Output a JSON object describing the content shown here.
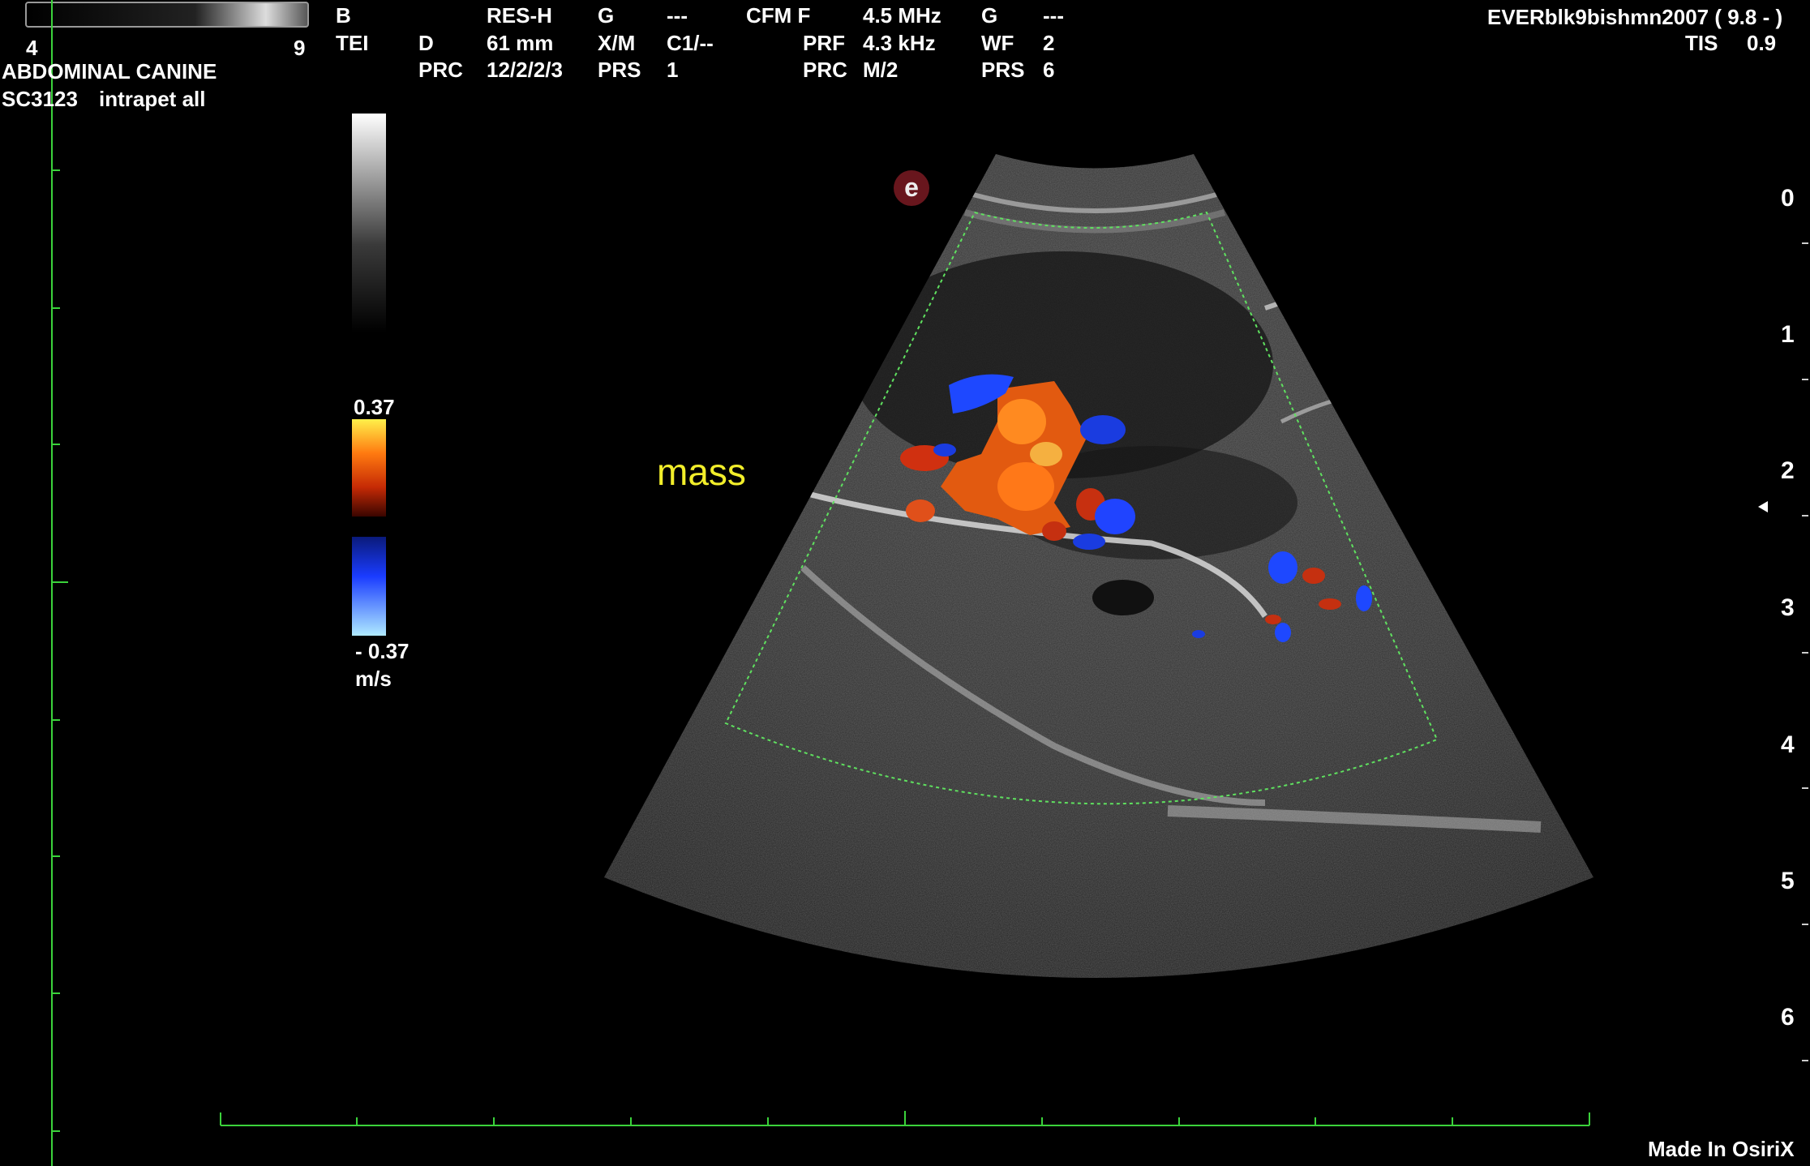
{
  "header": {
    "col1": [
      "B",
      "TEI"
    ],
    "col2": [
      "D",
      "PRC"
    ],
    "col3": [
      "RES-H",
      "61 mm",
      "12/2/2/3"
    ],
    "col4": [
      "G",
      "X/M",
      "PRS"
    ],
    "col5": [
      "---",
      "C1/--",
      "1"
    ],
    "col6": [
      "CFM F",
      "PRF",
      "PRC"
    ],
    "col7": [
      "4.5 MHz",
      "4.3 kHz",
      "M/2"
    ],
    "col8": [
      "G",
      "WF",
      "PRS"
    ],
    "col9": [
      "---",
      "2",
      "6"
    ],
    "top_right_overlay": "EVERblk9bishmn2007 (  9.8 - )",
    "tis_label": "TIS",
    "tis_value": "0.9"
  },
  "probe": {
    "range_min": "4",
    "range_max": "9",
    "preset": "ABDOMINAL CANINE",
    "model": "SC3123",
    "app": "intrapet all"
  },
  "color_scale": {
    "max": "0.37",
    "min": "- 0.37",
    "unit": "m/s"
  },
  "annotation": "mass",
  "depth_scale": [
    "0",
    "1",
    "2",
    "3",
    "4",
    "5",
    "6"
  ],
  "watermark": "Made In OsiriX",
  "logo_icon": "e-logo-icon"
}
